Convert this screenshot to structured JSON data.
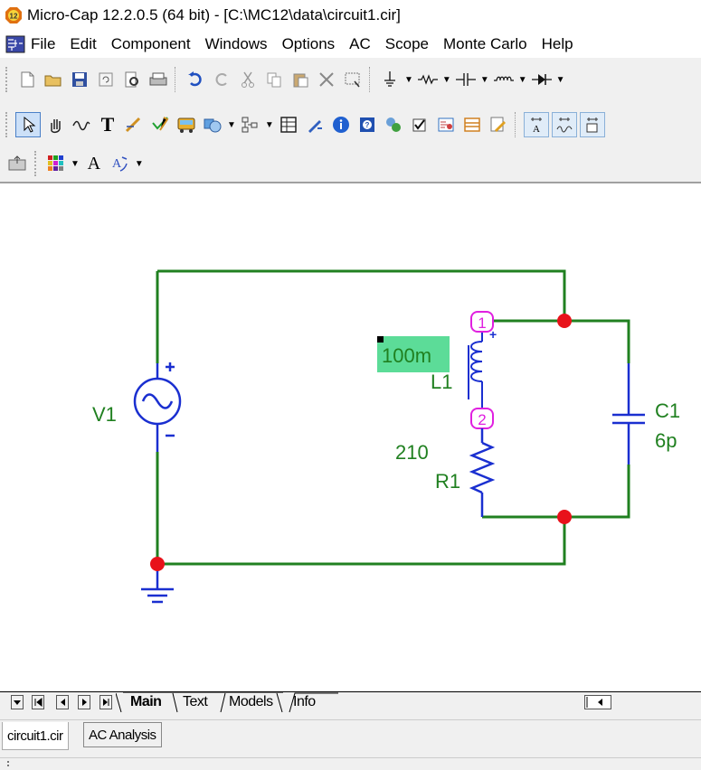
{
  "window": {
    "title": "Micro-Cap 12.2.0.5 (64 bit) - [C:\\MC12\\data\\circuit1.cir]",
    "app_badge": "12"
  },
  "menu": {
    "items": [
      "File",
      "Edit",
      "Component",
      "Windows",
      "Options",
      "AC",
      "Scope",
      "Monte Carlo",
      "Help"
    ]
  },
  "toolbar": {
    "text_tool": "T",
    "font_tool": "A"
  },
  "circuit": {
    "sources": [
      {
        "name": "V1",
        "plus": "+",
        "minus": "-"
      }
    ],
    "inductor": {
      "name": "L1",
      "value": "100m",
      "plus": "+"
    },
    "resistor": {
      "name": "R1",
      "value": "210"
    },
    "capacitor": {
      "name": "C1",
      "value": "6p"
    },
    "nodes": [
      "1",
      "2"
    ]
  },
  "sheet_tabs": [
    "Main",
    "Text",
    "Models",
    "Info"
  ],
  "doc_tabs": [
    "circuit1.cir",
    "AC Analysis"
  ],
  "colors": {
    "wire": "#208020",
    "component": "#1a2fd0",
    "node_dot": "#e8121a",
    "node_label": "#e020e0",
    "selection_highlight": "#5cdc98"
  }
}
